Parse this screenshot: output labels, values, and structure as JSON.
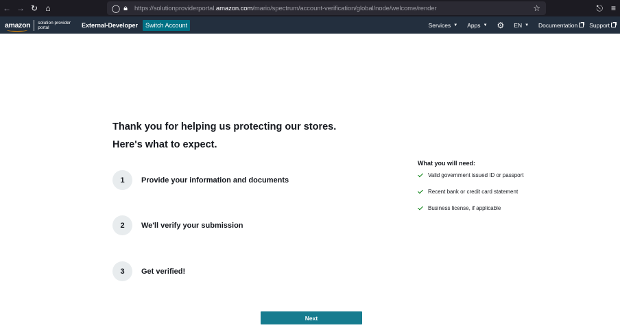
{
  "browser": {
    "url_prefix": "https://solutionproviderportal.",
    "url_domain": "amazon.com",
    "url_path": "/mario/spectrum/account-verification/global/node/welcome/render"
  },
  "header": {
    "logo_text": "amazon",
    "logo_sub_line1": "solution provider",
    "logo_sub_line2": "portal",
    "account_name": "External-Developer",
    "switch_account": "Switch Account",
    "services": "Services",
    "apps": "Apps",
    "language": "EN",
    "documentation": "Documentation",
    "support": "Support"
  },
  "main": {
    "heading_line1": "Thank you for helping us protecting our stores.",
    "heading_line2": "Here's what to expect.",
    "steps": [
      {
        "num": "1",
        "label": "Provide your information and documents"
      },
      {
        "num": "2",
        "label": "We'll verify your submission"
      },
      {
        "num": "3",
        "label": "Get verified!"
      }
    ],
    "needs_title": "What you will need:",
    "needs": [
      "Valid government issued ID or passport",
      "Recent bank or credit card statement",
      "Business license, if applicable"
    ],
    "next_label": "Next"
  },
  "colors": {
    "header_bg": "#232f3e",
    "accent_teal": "#007185",
    "logo_smile": "#ff9900",
    "check_green": "#037f0c"
  }
}
